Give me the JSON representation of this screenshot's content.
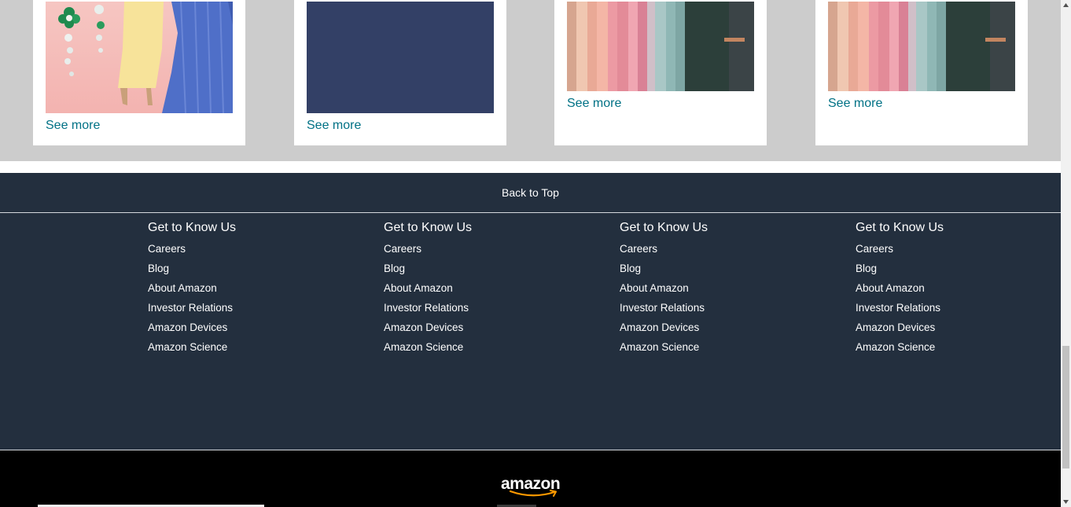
{
  "cards": [
    {
      "see_more": "See more"
    },
    {
      "see_more": "See more"
    },
    {
      "see_more": "See more"
    },
    {
      "see_more": "See more"
    }
  ],
  "back_to_top": "Back to Top",
  "footer": {
    "columns": [
      {
        "heading": "Get to Know Us",
        "links": [
          "Careers",
          "Blog",
          "About Amazon",
          "Investor Relations",
          "Amazon Devices",
          "Amazon Science"
        ]
      },
      {
        "heading": "Get to Know Us",
        "links": [
          "Careers",
          "Blog",
          "About Amazon",
          "Investor Relations",
          "Amazon Devices",
          "Amazon Science"
        ]
      },
      {
        "heading": "Get to Know Us",
        "links": [
          "Careers",
          "Blog",
          "About Amazon",
          "Investor Relations",
          "Amazon Devices",
          "Amazon Science"
        ]
      },
      {
        "heading": "Get to Know Us",
        "links": [
          "Careers",
          "Blog",
          "About Amazon",
          "Investor Relations",
          "Amazon Devices",
          "Amazon Science"
        ]
      }
    ]
  },
  "logo": {
    "text": "amazon"
  },
  "colors": {
    "footer_bg": "#232f3e",
    "logo_bar_bg": "#000000",
    "link_teal": "#007185",
    "band_gray": "#cccccc",
    "smile_orange": "#ff9900"
  }
}
